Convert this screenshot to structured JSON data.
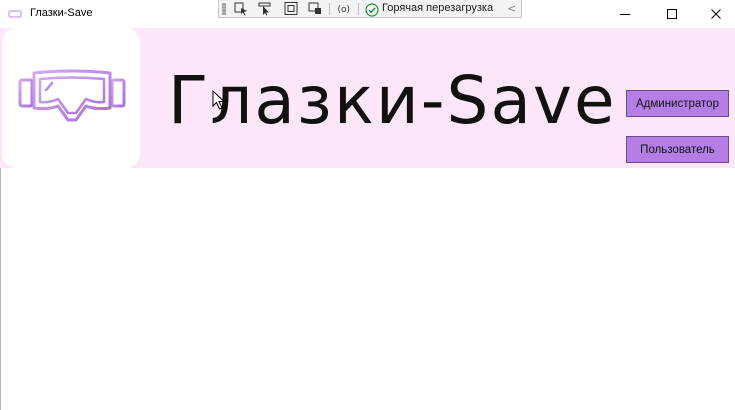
{
  "window": {
    "title": "Глазки-Save",
    "app_icon": "glasses-icon"
  },
  "debug_toolbar": {
    "tools": [
      "select-element-icon",
      "pointer-icon",
      "layout-adorner-icon",
      "track-focus-icon",
      "binding-failures-icon"
    ],
    "hot_reload_label": "Горячая перезагрузка",
    "hot_reload_status": "ok",
    "collapse_glyph": "<"
  },
  "window_controls": [
    "minimize-icon",
    "maximize-icon",
    "close-icon"
  ],
  "header": {
    "background": "#fde6f8",
    "brand": "Глазки-Save",
    "logo": "goggles-logo",
    "logo_colors": [
      "#c79ae8",
      "#a86ee0"
    ],
    "buttons": {
      "admin": "Администратор",
      "user": "Пользователь"
    },
    "button_color": "#b47ee6"
  }
}
